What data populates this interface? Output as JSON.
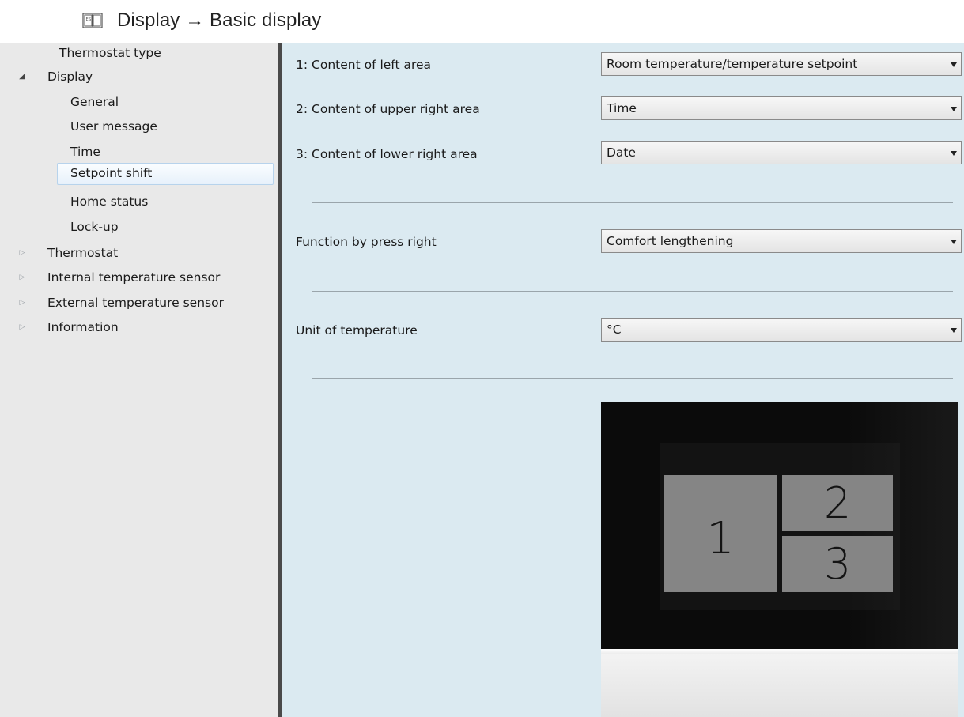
{
  "heading": {
    "icon": "book-icon",
    "text": "Display → Basic display"
  },
  "sidebar": {
    "items": [
      {
        "label": "Thermostat type",
        "level": 1,
        "arrow": null
      },
      {
        "label": "Display",
        "level": 0,
        "arrow": "expanded"
      },
      {
        "label": "General",
        "level": 1,
        "arrow": null
      },
      {
        "label": "User message",
        "level": 1,
        "arrow": null
      },
      {
        "label": "Time",
        "level": 1,
        "arrow": null
      },
      {
        "label": "Setpoint shift",
        "level": 1,
        "arrow": null,
        "selected": true
      },
      {
        "label": "Home status",
        "level": 1,
        "arrow": null
      },
      {
        "label": "Lock-up",
        "level": 1,
        "arrow": null
      },
      {
        "label": "Thermostat",
        "level": 0,
        "arrow": "collapsed"
      },
      {
        "label": "Internal temperature sensor",
        "level": 0,
        "arrow": "collapsed"
      },
      {
        "label": "External temperature sensor",
        "level": 0,
        "arrow": "collapsed"
      },
      {
        "label": "Information",
        "level": 0,
        "arrow": "collapsed"
      }
    ]
  },
  "params": [
    {
      "label": "1: Content of left area",
      "value": "Room temperature/temperature setpoint"
    },
    {
      "label": "2: Content of upper right area",
      "value": "Time"
    },
    {
      "label": "3: Content of lower right area",
      "value": "Date"
    },
    {
      "label": "Function by press right",
      "value": "Comfort lengthening"
    },
    {
      "label": "Unit of temperature",
      "value": "°C"
    }
  ],
  "device_preview": {
    "area_1": "1",
    "area_2": "2",
    "area_3": "3"
  },
  "colors": {
    "sidebar_bg": "#e9e9e9",
    "main_bg": "#dbeaf1",
    "selection_border": "#b7d3ec"
  }
}
